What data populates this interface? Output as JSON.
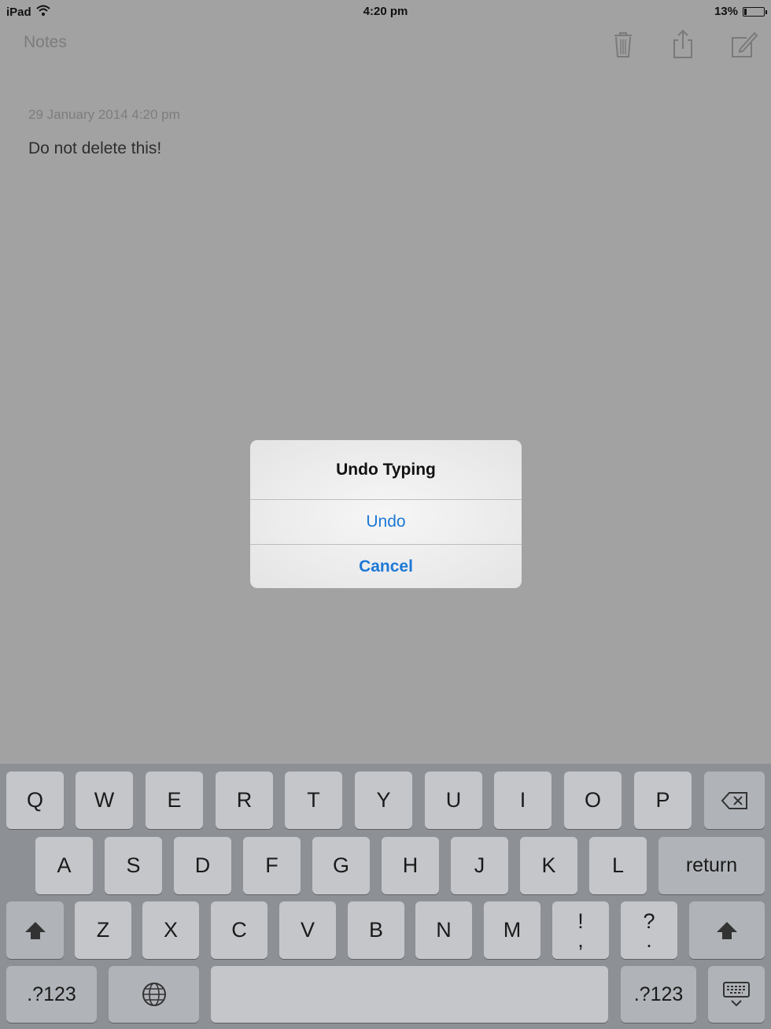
{
  "status_bar": {
    "device": "iPad",
    "time": "4:20 pm",
    "battery_percent": "13%",
    "battery_level": 0.13
  },
  "nav": {
    "back_label": "Notes",
    "icons": [
      "trash-icon",
      "share-icon",
      "compose-icon"
    ]
  },
  "note": {
    "date": "29 January 2014 4:20 pm",
    "body": "Do not delete this!"
  },
  "alert": {
    "title": "Undo Typing",
    "undo_label": "Undo",
    "cancel_label": "Cancel"
  },
  "keyboard": {
    "row1": [
      "Q",
      "W",
      "E",
      "R",
      "T",
      "Y",
      "U",
      "I",
      "O",
      "P"
    ],
    "row2": [
      "A",
      "S",
      "D",
      "F",
      "G",
      "H",
      "J",
      "K",
      "L"
    ],
    "row3": [
      "Z",
      "X",
      "C",
      "V",
      "B",
      "N",
      "M"
    ],
    "return_label": "return",
    "numbers_label": ".?123",
    "punct1_top": "!",
    "punct1_bottom": ",",
    "punct2_top": "?",
    "punct2_bottom": "."
  },
  "colors": {
    "accent": "#1c78d6",
    "background": "#a2a2a2",
    "keyboard": "#8d9095"
  }
}
